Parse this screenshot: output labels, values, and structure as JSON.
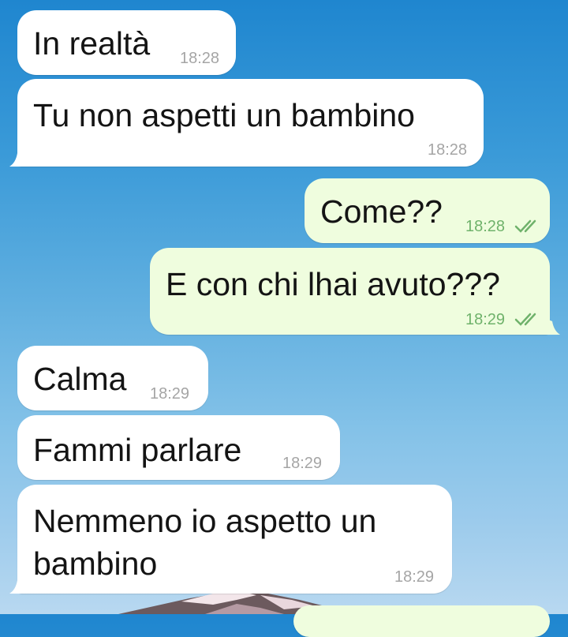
{
  "messages": [
    {
      "id": "m1",
      "direction": "incoming",
      "text": "In realtà",
      "time": "18:28"
    },
    {
      "id": "m2",
      "direction": "incoming",
      "text": "Tu non aspetti un bambino",
      "time": "18:28"
    },
    {
      "id": "m3",
      "direction": "outgoing",
      "text": "Come??",
      "time": "18:28",
      "status": "read"
    },
    {
      "id": "m4",
      "direction": "outgoing",
      "text": "E con chi lhai avuto???",
      "time": "18:29",
      "status": "read"
    },
    {
      "id": "m5",
      "direction": "incoming",
      "text": "Calma",
      "time": "18:29"
    },
    {
      "id": "m6",
      "direction": "incoming",
      "text": "Fammi parlare",
      "time": "18:29"
    },
    {
      "id": "m7",
      "direction": "incoming",
      "text_lines": [
        "Nemmeno io aspetto un",
        "bambino"
      ],
      "time": "18:29"
    }
  ],
  "colors": {
    "incoming_bubble": "#ffffff",
    "outgoing_bubble": "#effdde",
    "outgoing_time": "#6fb26b",
    "incoming_time": "#a5a5a5"
  },
  "icons": {
    "read_status": "double-check-icon"
  }
}
